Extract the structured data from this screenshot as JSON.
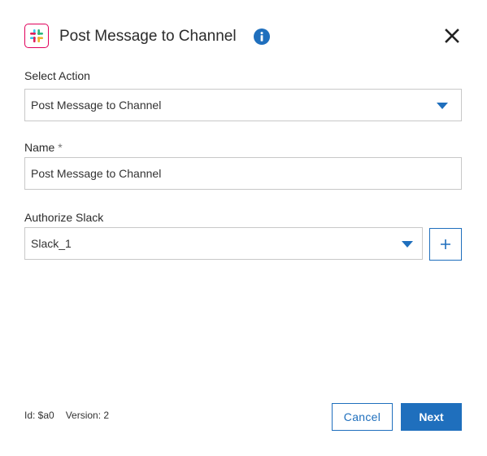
{
  "header": {
    "title": "Post Message to Channel",
    "app_icon": "slack-icon",
    "info_icon": "info-icon",
    "close_icon": "close-icon"
  },
  "select_action": {
    "label": "Select Action",
    "value": "Post Message to Channel"
  },
  "name": {
    "label": "Name",
    "required_marker": "*",
    "value": "Post Message to Channel"
  },
  "authorize": {
    "label": "Authorize Slack",
    "value": "Slack_1",
    "add_label": "+"
  },
  "footer": {
    "id_text": "Id: $a0",
    "version_text": "Version: 2",
    "cancel_label": "Cancel",
    "next_label": "Next"
  },
  "colors": {
    "accent": "#1f6fbd",
    "app_icon_border": "#e0005a"
  }
}
